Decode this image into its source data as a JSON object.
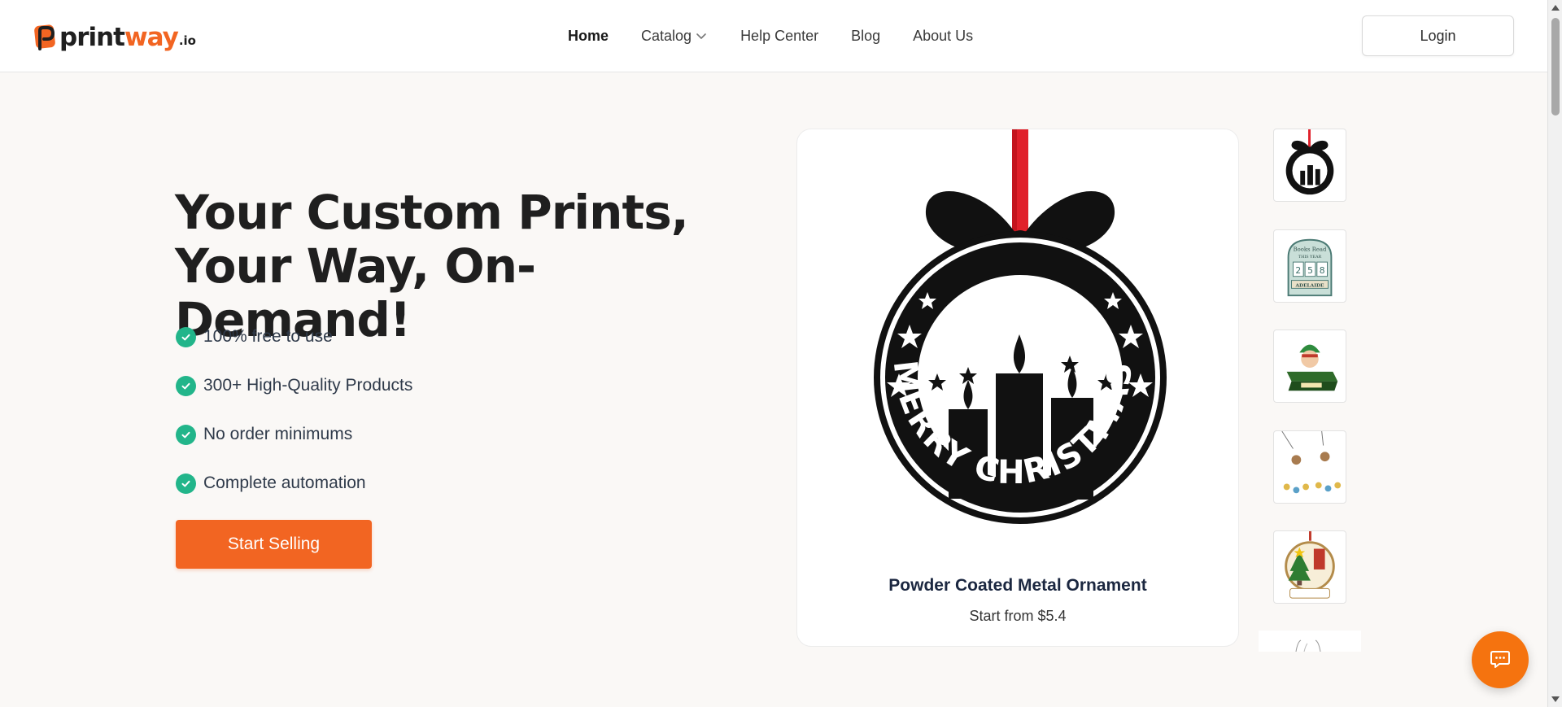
{
  "brand": {
    "name_part1": "print",
    "name_part2": "way",
    "suffix": ".io",
    "accent": "#f26522"
  },
  "nav": {
    "items": [
      {
        "label": "Home",
        "active": true
      },
      {
        "label": "Catalog",
        "has_dropdown": true
      },
      {
        "label": "Help Center"
      },
      {
        "label": "Blog"
      },
      {
        "label": "About Us"
      }
    ],
    "login_label": "Login"
  },
  "hero": {
    "title_line1": "Your Custom Prints,",
    "title_line2": "Your Way, On-Demand!",
    "features": [
      "100% free to use",
      "300+ High-Quality Products",
      "No order minimums",
      "Complete automation"
    ],
    "cta_label": "Start Selling",
    "check_color": "#22b58a"
  },
  "product": {
    "name": "Powder Coated Metal Ornament",
    "price": "Start from $5.4",
    "ornament_text": "MERRY CHRISTMAS"
  },
  "thumbnails": [
    {
      "icon": "christmas-ornament-icon"
    },
    {
      "icon": "books-read-sign-icon",
      "text_top": "Books Read",
      "text_mid": "THIS YEAR",
      "digits": [
        "2",
        "5",
        "8"
      ],
      "text_bottom": "ADELAIDE"
    },
    {
      "icon": "elf-box-icon"
    },
    {
      "icon": "moon-ornaments-icon"
    },
    {
      "icon": "christmas-tree-ornament-icon"
    },
    {
      "icon": "partial-thumbnail-icon"
    }
  ],
  "chat": {
    "icon": "chat-icon",
    "color": "#f5730f"
  }
}
